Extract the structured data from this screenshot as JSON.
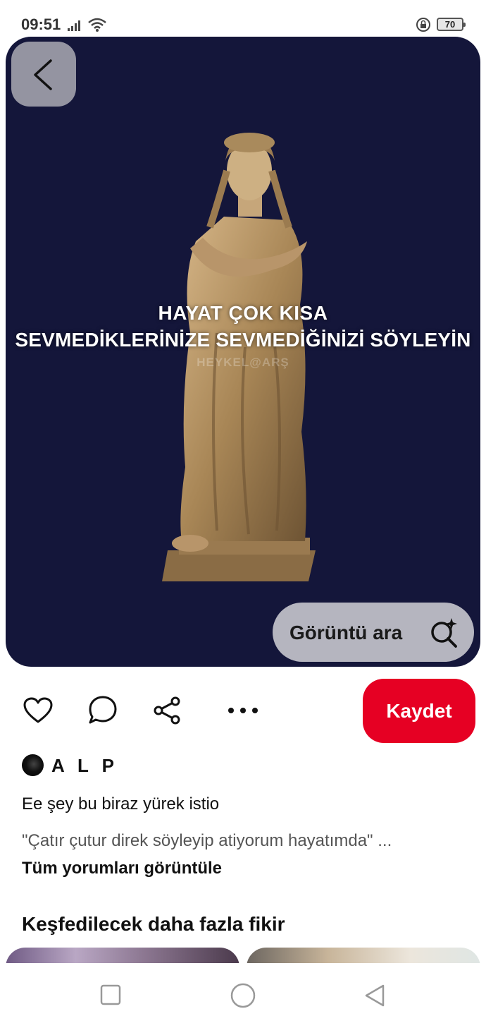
{
  "status_bar": {
    "time": "09:51",
    "battery": "70",
    "icons": [
      "signal-icon",
      "wifi-icon",
      "rotation-lock-icon",
      "battery-icon"
    ]
  },
  "pin": {
    "image": {
      "line1": "HAYAT ÇOK KISA",
      "line2": "SEVMEDİKLERİNİZE SEVMEDİĞİNİZİ SÖYLEYİN",
      "watermark": "HEYKEL@ARŞ"
    },
    "image_search_label": "Görüntü ara",
    "save_label": "Kaydet",
    "author": "A L P",
    "description": "Ee şey bu biraz yürek istio",
    "comment": "\"Çatır çutur direk söyleyip atiyorum hayatımda\" ...",
    "all_comments_label": "Tüm yorumları görüntüle",
    "more_ideas_title": "Keşfedilecek daha fazla fikir"
  },
  "actions": [
    "heart-icon",
    "comment-icon",
    "share-icon",
    "more-icon"
  ],
  "colors": {
    "save_button": "#e60023",
    "hero_background": "#14163a"
  }
}
